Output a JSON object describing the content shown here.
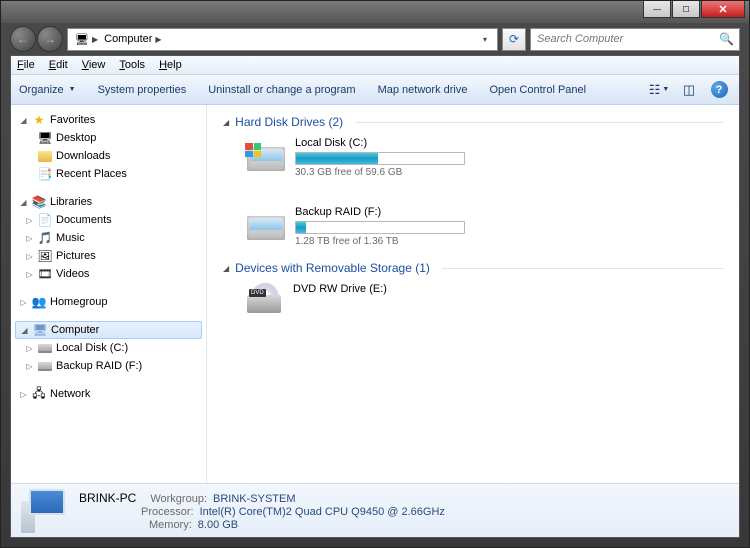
{
  "titlebar": {
    "min": "—",
    "max": "☐",
    "close": "✕"
  },
  "nav": {
    "back": "←",
    "forward": "→",
    "refresh": "⟳"
  },
  "address": {
    "root_icon": "🖥",
    "segment": "Computer",
    "arrow": "▶",
    "drop": "▾"
  },
  "search": {
    "placeholder": "Search Computer"
  },
  "menu": [
    "File",
    "Edit",
    "View",
    "Tools",
    "Help"
  ],
  "toolbar": {
    "organize": "Organize",
    "sysprops": "System properties",
    "uninstall": "Uninstall or change a program",
    "mapdrive": "Map network drive",
    "controlpanel": "Open Control Panel"
  },
  "tree": {
    "favorites": {
      "label": "Favorites",
      "items": [
        "Desktop",
        "Downloads",
        "Recent Places"
      ]
    },
    "libraries": {
      "label": "Libraries",
      "items": [
        "Documents",
        "Music",
        "Pictures",
        "Videos"
      ]
    },
    "homegroup": {
      "label": "Homegroup"
    },
    "computer": {
      "label": "Computer",
      "items": [
        "Local Disk (C:)",
        "Backup RAID (F:)"
      ]
    },
    "network": {
      "label": "Network"
    }
  },
  "sections": {
    "hdd": {
      "title": "Hard Disk Drives (2)"
    },
    "removable": {
      "title": "Devices with Removable Storage (1)"
    }
  },
  "drives": {
    "c": {
      "name": "Local Disk (C:)",
      "free_text": "30.3 GB free of 59.6 GB",
      "fill_pct": 49
    },
    "f": {
      "name": "Backup RAID (F:)",
      "free_text": "1.28 TB free of 1.36 TB",
      "fill_pct": 6
    },
    "e": {
      "name": "DVD RW Drive (E:)"
    }
  },
  "details": {
    "name": "BRINK-PC",
    "workgroup_lbl": "Workgroup:",
    "workgroup": "BRINK-SYSTEM",
    "processor_lbl": "Processor:",
    "processor": "Intel(R) Core(TM)2 Quad  CPU   Q9450  @ 2.66GHz",
    "memory_lbl": "Memory:",
    "memory": "8.00 GB"
  }
}
